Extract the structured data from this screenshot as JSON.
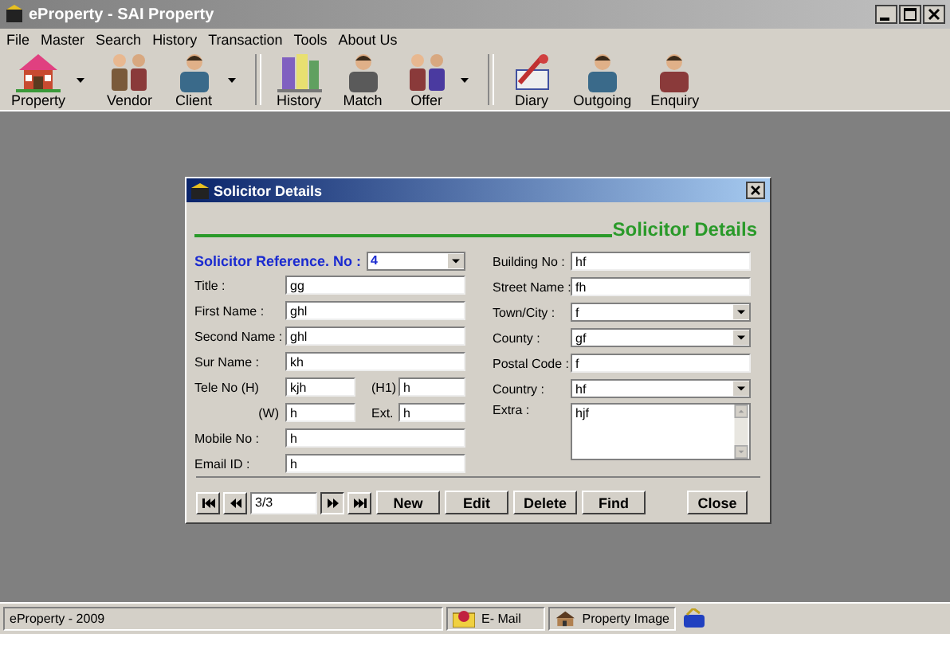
{
  "window": {
    "title": "eProperty - SAI Property"
  },
  "menu": [
    "File",
    "Master",
    "Search",
    "History",
    "Transaction",
    "Tools",
    "About Us"
  ],
  "toolbar_groups": [
    [
      {
        "label": "Property",
        "dropdown": true
      },
      {
        "label": "Vendor",
        "dropdown": false
      },
      {
        "label": "Client",
        "dropdown": true
      }
    ],
    [
      {
        "label": "History",
        "dropdown": false
      },
      {
        "label": "Match",
        "dropdown": false
      },
      {
        "label": "Offer",
        "dropdown": true
      }
    ],
    [
      {
        "label": "Diary",
        "dropdown": false
      },
      {
        "label": "Outgoing",
        "dropdown": false
      },
      {
        "label": "Enquiry",
        "dropdown": false
      }
    ]
  ],
  "dialog": {
    "title": "Solicitor Details",
    "heading": "Solicitor Details",
    "reference": {
      "label": "Solicitor Reference. No :",
      "value": "4"
    },
    "left_fields": [
      {
        "kind": "text",
        "label": "Title :",
        "value": "gg"
      },
      {
        "kind": "text",
        "label": "First Name :",
        "value": "ghl"
      },
      {
        "kind": "text",
        "label": "Second Name :",
        "value": "ghl"
      },
      {
        "kind": "text",
        "label": "Sur Name :",
        "value": "kh"
      },
      {
        "kind": "pair",
        "label": "Tele No (H)",
        "value": "kjh",
        "label_2": "(H1)",
        "value_2": "h"
      },
      {
        "kind": "pair",
        "label": "(W)",
        "value": "h",
        "label_2": "Ext.",
        "value_2": "h"
      },
      {
        "kind": "text",
        "label": "Mobile No :",
        "value": "h"
      },
      {
        "kind": "text",
        "label": "Email ID :",
        "value": "h"
      }
    ],
    "right_fields": [
      {
        "kind": "text",
        "label": "Building No :",
        "value": "hf"
      },
      {
        "kind": "text",
        "label": "Street Name :",
        "value": "fh"
      },
      {
        "kind": "combo",
        "label": "Town/City :",
        "value": "f"
      },
      {
        "kind": "combo",
        "label": "County :",
        "value": "gf"
      },
      {
        "kind": "text",
        "label": "Postal Code :",
        "value": "f"
      },
      {
        "kind": "combo",
        "label": "Country :",
        "value": "hf"
      },
      {
        "kind": "memo",
        "label": "Extra :",
        "value": "hjf"
      }
    ],
    "record": "3/3",
    "buttons": [
      "New",
      "Edit",
      "Delete",
      "Find"
    ],
    "close": "Close"
  },
  "status_bar": {
    "text": "eProperty - 2009",
    "panels": [
      "E- Mail",
      "Property Image"
    ]
  }
}
